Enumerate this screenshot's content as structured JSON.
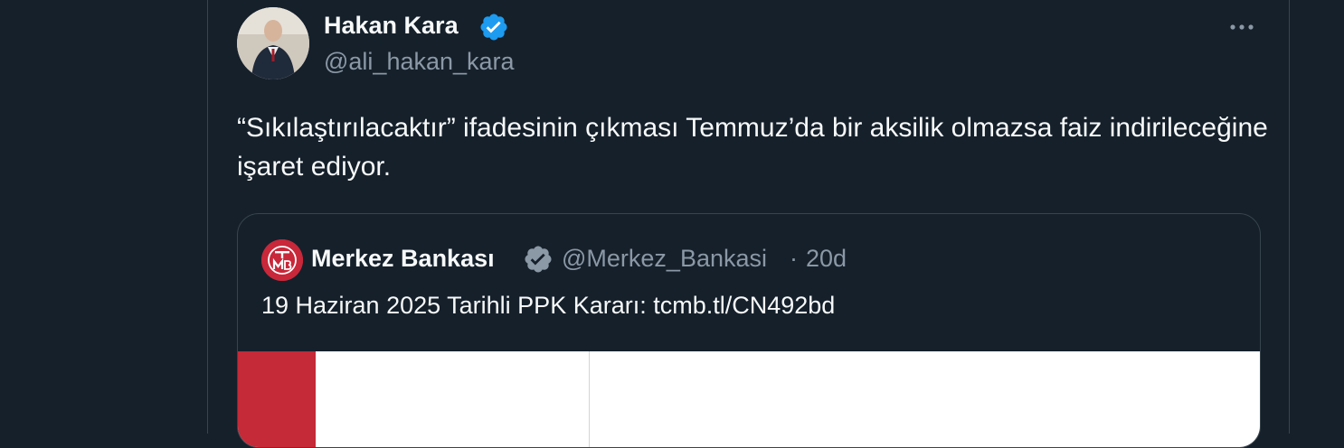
{
  "tweet": {
    "author": {
      "name": "Hakan Kara",
      "handle": "@ali_hakan_kara",
      "verified": true
    },
    "text": "“Sıkılaştırılacaktır” ifadesinin çıkması Temmuz’da bir aksilik olmazsa faiz indirileceğine işaret ediyor.",
    "more_icon": "more-horizontal-icon"
  },
  "quote": {
    "author": {
      "name": "Merkez Bankası",
      "handle": "@Merkez_Bankasi",
      "verified_type": "gray"
    },
    "separator": "·",
    "time": "20d",
    "text": "19 Haziran 2025 Tarihli PPK Kararı: tcmb.tl/CN492bd"
  },
  "colors": {
    "background": "#15202b",
    "verified_blue": "#1d9bf0",
    "verified_gray": "#8b98a5",
    "tcmb_red": "#c8283a"
  }
}
